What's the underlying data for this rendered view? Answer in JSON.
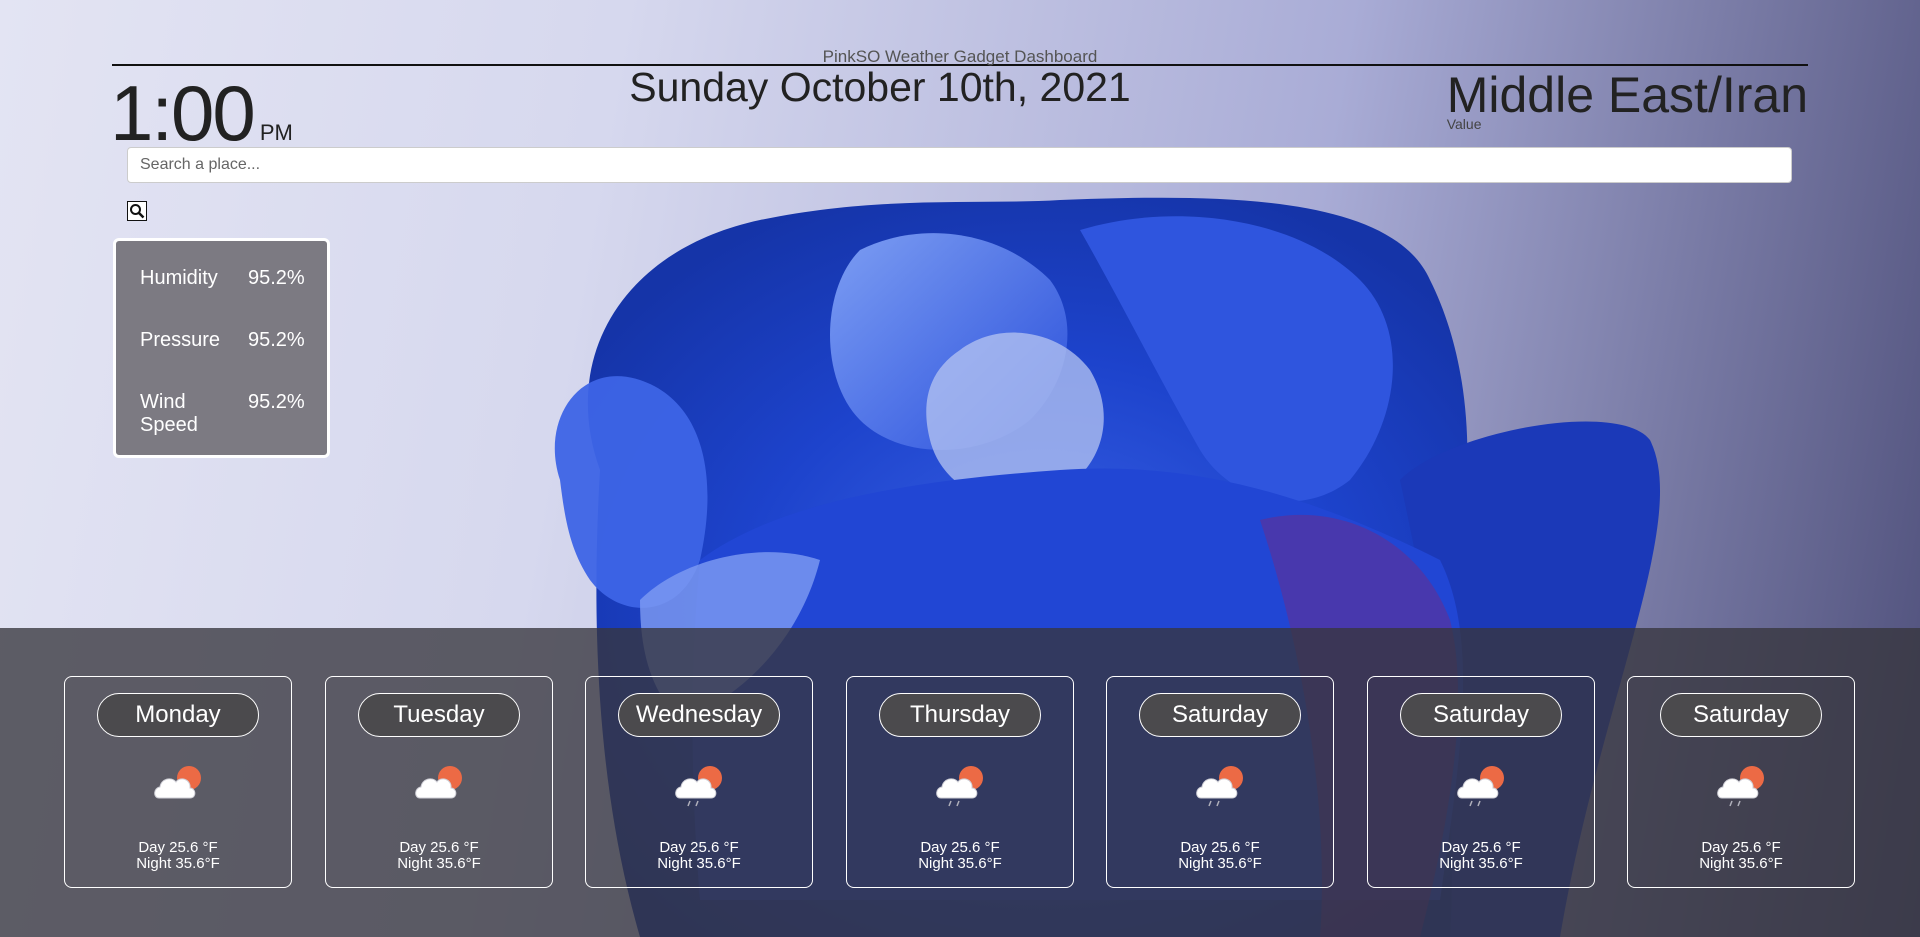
{
  "header": {
    "app_title": "PinkSO Weather Gadget Dashboard",
    "time": "1:00",
    "ampm": "PM",
    "date": "Sunday October 10th, 2021",
    "timezone": "Middle East/Iran",
    "timezone_value": "Value"
  },
  "search": {
    "placeholder": "Search a place...",
    "value": ""
  },
  "stats": [
    {
      "label": "Humidity",
      "value": "95.2%"
    },
    {
      "label": "Pressure",
      "value": "95.2%"
    },
    {
      "label": "Wind Speed",
      "value": "95.2%"
    }
  ],
  "forecast": [
    {
      "day": "Monday",
      "icon": "cloud-sun-icon",
      "day_temp": "Day 25.6 °F",
      "night_temp": "Night 35.6°F"
    },
    {
      "day": "Tuesday",
      "icon": "cloud-sun-icon",
      "day_temp": "Day 25.6 °F",
      "night_temp": "Night 35.6°F"
    },
    {
      "day": "Wednesday",
      "icon": "cloud-sun-rain-icon",
      "day_temp": "Day 25.6 °F",
      "night_temp": "Night 35.6°F"
    },
    {
      "day": "Thursday",
      "icon": "cloud-sun-rain-icon",
      "day_temp": "Day 25.6 °F",
      "night_temp": "Night 35.6°F"
    },
    {
      "day": "Saturday",
      "icon": "cloud-sun-rain-icon",
      "day_temp": "Day 25.6 °F",
      "night_temp": "Night 35.6°F"
    },
    {
      "day": "Saturday",
      "icon": "cloud-sun-rain-icon",
      "day_temp": "Day 25.6 °F",
      "night_temp": "Night 35.6°F"
    },
    {
      "day": "Saturday",
      "icon": "cloud-sun-rain-icon",
      "day_temp": "Day 25.6 °F",
      "night_temp": "Night 35.6°F"
    }
  ],
  "colors": {
    "stats_card_bg": "#78767d",
    "forecast_panel_bg": "#37363e",
    "sun": "#ec6a45",
    "rose": "#1f4fd6"
  }
}
